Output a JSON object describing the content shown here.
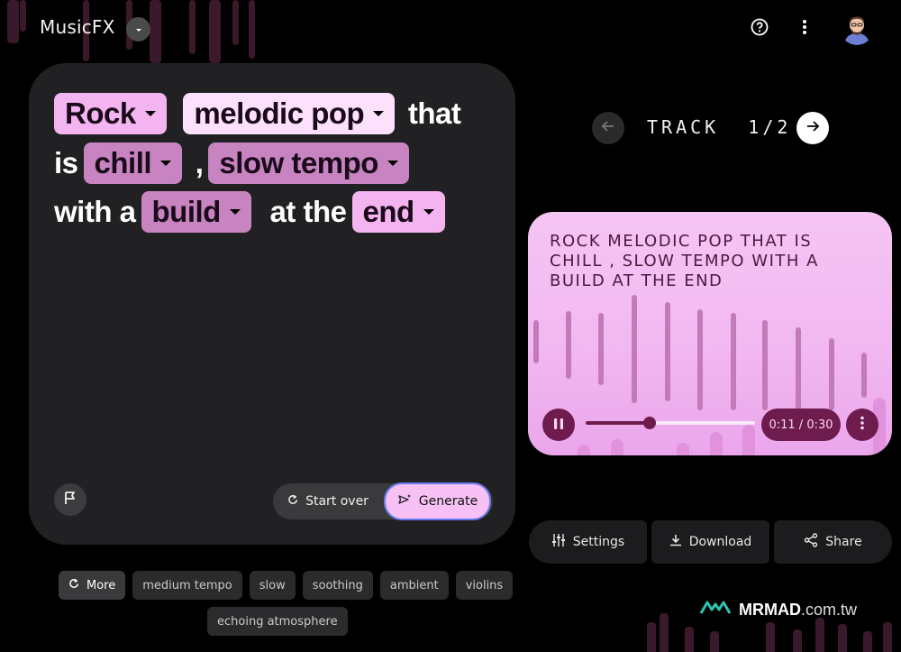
{
  "app": {
    "title": "MusicFX"
  },
  "prompt": {
    "line1": {
      "chip1": "Rock",
      "chip2": "melodic pop",
      "word": "that"
    },
    "line2": {
      "word": "is",
      "chip1": "chill",
      "sep": ",",
      "chip2": "slow tempo"
    },
    "line3": {
      "word1": "with a",
      "chip1": "build",
      "word2": "at the",
      "chip2": "end"
    }
  },
  "actions": {
    "start_over": "Start over",
    "generate": "Generate"
  },
  "suggestions": {
    "more": "More",
    "row1": [
      "medium tempo",
      "slow",
      "soothing",
      "ambient",
      "violins"
    ],
    "row2": [
      "echoing atmosphere"
    ]
  },
  "track_nav": {
    "label": "TRACK  1/2"
  },
  "track": {
    "description": "ROCK MELODIC POP THAT IS CHILL , SLOW TEMPO WITH A BUILD AT THE END",
    "time": "0:11 / 0:30",
    "progress": 0.38
  },
  "bottom_actions": {
    "settings": "Settings",
    "download": "Download",
    "share": "Share"
  },
  "watermark": {
    "brand": "MRMAD",
    "tld": ".com.tw"
  },
  "colors": {
    "chip_pink": "#f3b4f0",
    "track_dark": "#6e1b4d",
    "generate_border": "#6a7cf0"
  }
}
